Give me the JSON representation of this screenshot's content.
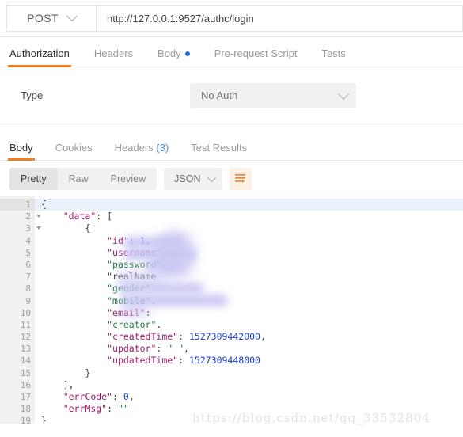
{
  "request_bar": {
    "method": "POST",
    "method_caret_icon": "chevron-down-icon",
    "url": "http://127.0.0.1:9527/authc/login"
  },
  "request_tabs": [
    {
      "label": "Authorization",
      "active": true,
      "dot": false
    },
    {
      "label": "Headers",
      "active": false,
      "dot": false
    },
    {
      "label": "Body",
      "active": false,
      "dot": true
    },
    {
      "label": "Pre-request Script",
      "active": false,
      "dot": false
    },
    {
      "label": "Tests",
      "active": false,
      "dot": false
    }
  ],
  "auth_panel": {
    "type_label": "Type",
    "selected_type": "No Auth",
    "caret_icon": "chevron-down-icon"
  },
  "response_tabs": [
    {
      "label": "Body",
      "count": "",
      "active": true
    },
    {
      "label": "Cookies",
      "count": "",
      "active": false
    },
    {
      "label": "Headers",
      "count": "(3)",
      "active": false
    },
    {
      "label": "Test Results",
      "count": "",
      "active": false
    }
  ],
  "format_toolbar": {
    "view_modes": [
      {
        "label": "Pretty",
        "active": true
      },
      {
        "label": "Raw",
        "active": false
      },
      {
        "label": "Preview",
        "active": false
      }
    ],
    "language": "JSON",
    "language_caret_icon": "chevron-down-icon",
    "beautify_icon": "format-wrap-icon"
  },
  "response_body": {
    "lines": [
      {
        "num": "1",
        "fold": true,
        "highlight": true,
        "text": "{"
      },
      {
        "num": "2",
        "fold": true,
        "highlight": false,
        "text": "    \"data\": ["
      },
      {
        "num": "3",
        "fold": true,
        "highlight": false,
        "text": "        {"
      },
      {
        "num": "4",
        "fold": false,
        "highlight": false,
        "text": "            \"id\": 1,"
      },
      {
        "num": "5",
        "fold": false,
        "highlight": false,
        "text": "            \"username\": "
      },
      {
        "num": "6",
        "fold": false,
        "highlight": false,
        "text": "            \"password\""
      },
      {
        "num": "7",
        "fold": false,
        "highlight": false,
        "text": "            \"realName"
      },
      {
        "num": "8",
        "fold": false,
        "highlight": false,
        "text": "            \"gender\""
      },
      {
        "num": "9",
        "fold": false,
        "highlight": false,
        "text": "            \"mobile\"."
      },
      {
        "num": "10",
        "fold": false,
        "highlight": false,
        "text": "            \"email\": "
      },
      {
        "num": "11",
        "fold": false,
        "highlight": false,
        "text": "            \"creator\"."
      },
      {
        "num": "12",
        "fold": false,
        "highlight": false,
        "text": "            \"createdTime\": 1527309442000,"
      },
      {
        "num": "13",
        "fold": false,
        "highlight": false,
        "text": "            \"updator\": \" \","
      },
      {
        "num": "14",
        "fold": false,
        "highlight": false,
        "text": "            \"updatedTime\": 1527309448000"
      },
      {
        "num": "15",
        "fold": false,
        "highlight": false,
        "text": "        }"
      },
      {
        "num": "16",
        "fold": false,
        "highlight": false,
        "text": "    ],"
      },
      {
        "num": "17",
        "fold": false,
        "highlight": false,
        "text": "    \"errCode\": 0,"
      },
      {
        "num": "18",
        "fold": false,
        "highlight": false,
        "text": "    \"errMsg\": \"\""
      },
      {
        "num": "19",
        "fold": false,
        "highlight": false,
        "text": "}"
      }
    ]
  },
  "watermark": {
    "text": "https://blog.csdn.net/qq_33532804"
  },
  "colors": {
    "accent_orange": "#ef7e22",
    "blue_dot": "#1d6fd8",
    "header_count_blue": "#4a90d9",
    "active_line": "#eaf2fb",
    "redaction": "#c9c7f3"
  }
}
